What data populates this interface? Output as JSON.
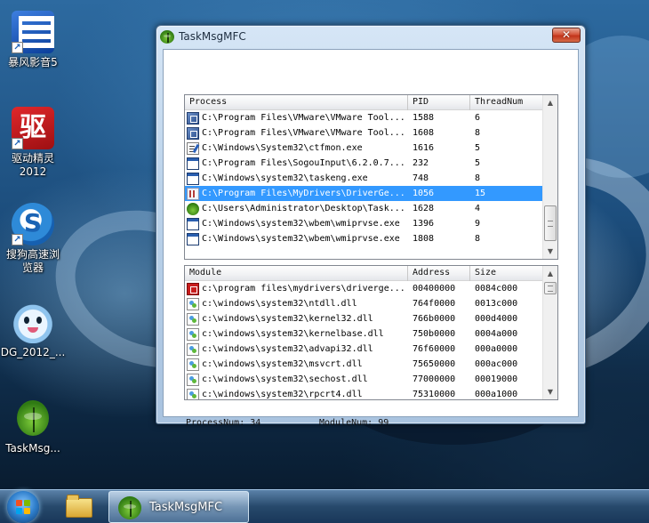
{
  "desktop": {
    "icons": [
      {
        "label": "暴风影音5",
        "icon": "storm-player-icon"
      },
      {
        "label": "驱动精灵2012",
        "icon": "driver-genius-icon",
        "glyph": "驱"
      },
      {
        "label": "搜狗高速浏览器",
        "icon": "sogou-browser-icon"
      },
      {
        "label": "DG_2012_...",
        "icon": "dg-mascot-icon"
      },
      {
        "label": "TaskMsg...",
        "icon": "taskmsg-bug-icon"
      }
    ]
  },
  "window": {
    "title": "TaskMsgMFC",
    "close_glyph": "✕",
    "process_list": {
      "columns": [
        "Process",
        "PID",
        "ThreadNum"
      ],
      "rows": [
        {
          "icon": "vmware-icon",
          "process": "C:\\Program Files\\VMware\\VMware Tool...",
          "pid": "1588",
          "threads": "6"
        },
        {
          "icon": "vmware-icon",
          "process": "C:\\Program Files\\VMware\\VMware Tool...",
          "pid": "1608",
          "threads": "8"
        },
        {
          "icon": "ctfmon-icon",
          "process": "C:\\Windows\\System32\\ctfmon.exe",
          "pid": "1616",
          "threads": "5"
        },
        {
          "icon": "app-window-icon",
          "process": "C:\\Program Files\\SogouInput\\6.2.0.7...",
          "pid": "232",
          "threads": "5"
        },
        {
          "icon": "app-window-icon",
          "process": "C:\\Windows\\system32\\taskeng.exe",
          "pid": "748",
          "threads": "8"
        },
        {
          "icon": "driver-app-icon",
          "process": "C:\\Program Files\\MyDrivers\\DriverGe...",
          "pid": "1056",
          "threads": "15",
          "selected": true
        },
        {
          "icon": "bug-app-icon",
          "process": "C:\\Users\\Administrator\\Desktop\\Task...",
          "pid": "1628",
          "threads": "4"
        },
        {
          "icon": "app-window-icon",
          "process": "C:\\Windows\\system32\\wbem\\wmiprvse.exe",
          "pid": "1396",
          "threads": "9"
        },
        {
          "icon": "app-window-icon",
          "process": "C:\\Windows\\system32\\wbem\\wmiprvse.exe",
          "pid": "1808",
          "threads": "8"
        }
      ]
    },
    "module_list": {
      "columns": [
        "Module",
        "Address",
        "Size"
      ],
      "rows": [
        {
          "icon": "driver-module-icon",
          "module": "c:\\program files\\mydrivers\\driverge...",
          "address": "00400000",
          "size": "0084c000"
        },
        {
          "icon": "dll-icon",
          "module": "c:\\windows\\system32\\ntdll.dll",
          "address": "764f0000",
          "size": "0013c000"
        },
        {
          "icon": "dll-icon",
          "module": "c:\\windows\\system32\\kernel32.dll",
          "address": "766b0000",
          "size": "000d4000"
        },
        {
          "icon": "dll-icon",
          "module": "c:\\windows\\system32\\kernelbase.dll",
          "address": "750b0000",
          "size": "0004a000"
        },
        {
          "icon": "dll-icon",
          "module": "c:\\windows\\system32\\advapi32.dll",
          "address": "76f60000",
          "size": "000a0000"
        },
        {
          "icon": "dll-icon",
          "module": "c:\\windows\\system32\\msvcrt.dll",
          "address": "75650000",
          "size": "000ac000"
        },
        {
          "icon": "dll-icon",
          "module": "c:\\windows\\system32\\sechost.dll",
          "address": "77000000",
          "size": "00019000"
        },
        {
          "icon": "dll-icon",
          "module": "c:\\windows\\system32\\rpcrt4.dll",
          "address": "75310000",
          "size": "000a1000"
        }
      ]
    },
    "status": {
      "process_num_label": "ProcessNum: 34",
      "module_num_label": "ModuleNum: 99"
    }
  },
  "taskbar": {
    "app_label": "TaskMsgMFC"
  },
  "colors": {
    "selection": "#3399ff",
    "close_button": "#c2341b"
  }
}
